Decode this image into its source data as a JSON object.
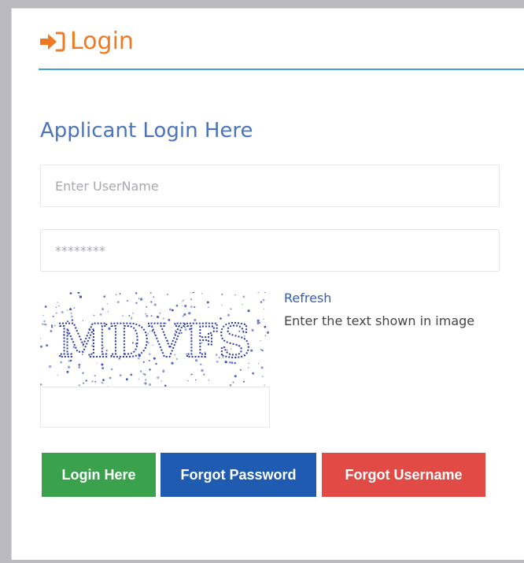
{
  "header": {
    "title": "Login",
    "icon": "sign-in-icon",
    "color": "#f07a22",
    "rule_color": "#3aa3de"
  },
  "form": {
    "subtitle": "Applicant Login Here",
    "username_placeholder": "Enter UserName",
    "password_placeholder": "********",
    "captcha_text": "MDVFS",
    "captcha_refresh": "Refresh",
    "captcha_hint": "Enter the text shown in image",
    "captcha_answer_value": ""
  },
  "buttons": {
    "login": {
      "label": "Login Here",
      "color": "#3aa24d"
    },
    "forgot_password": {
      "label": "Forgot Password",
      "color": "#1f5cb1"
    },
    "forgot_username": {
      "label": "Forgot Username",
      "color": "#e24a45"
    }
  }
}
